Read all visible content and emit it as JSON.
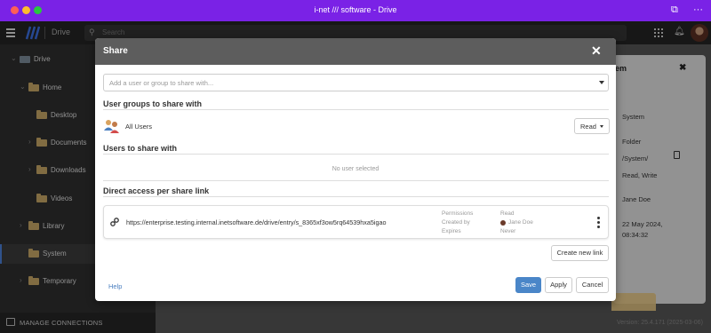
{
  "window": {
    "title": "i-net /// software - Drive"
  },
  "appbar": {
    "app_name": "Drive",
    "search_placeholder": "Search"
  },
  "sidebar": {
    "items": [
      {
        "label": "Drive"
      },
      {
        "label": "Home"
      },
      {
        "label": "Desktop"
      },
      {
        "label": "Documents"
      },
      {
        "label": "Downloads"
      },
      {
        "label": "Videos"
      },
      {
        "label": "Library"
      },
      {
        "label": "System"
      },
      {
        "label": "Temporary"
      }
    ],
    "manage_label": "MANAGE CONNECTIONS"
  },
  "details": {
    "title_fragment": "em",
    "values": [
      "System",
      "Folder",
      "/System/",
      "Read, Write",
      "Jane Doe",
      "22 May 2024,",
      "08:34:32"
    ]
  },
  "version": "Version: 25.4.171 (2025-03-06)",
  "dialog": {
    "title": "Share",
    "share_placeholder": "Add a user or group to share with...",
    "groups_title": "User groups to share with",
    "group": {
      "name": "All Users",
      "permission": "Read"
    },
    "users_title": "Users to share with",
    "no_user": "No user selected",
    "direct_title": "Direct access per share link",
    "link": {
      "url": "https://enterprise.testing.internal.inetsoftware.de/drive/entry/s_8365xf3ow5rq64539hxa5igao",
      "permissions_label": "Permissions",
      "permissions_value": "Read",
      "created_by_label": "Created by",
      "created_by_value": "Jane Doe",
      "expires_label": "Expires",
      "expires_value": "Never"
    },
    "create_link_label": "Create new link",
    "help_label": "Help",
    "save_label": "Save",
    "apply_label": "Apply",
    "cancel_label": "Cancel"
  },
  "colors": {
    "titlebar": "#7a22e6",
    "dialog_header": "#5d5d5d",
    "primary_button": "#4a86c8",
    "folder": "#c6a766"
  }
}
